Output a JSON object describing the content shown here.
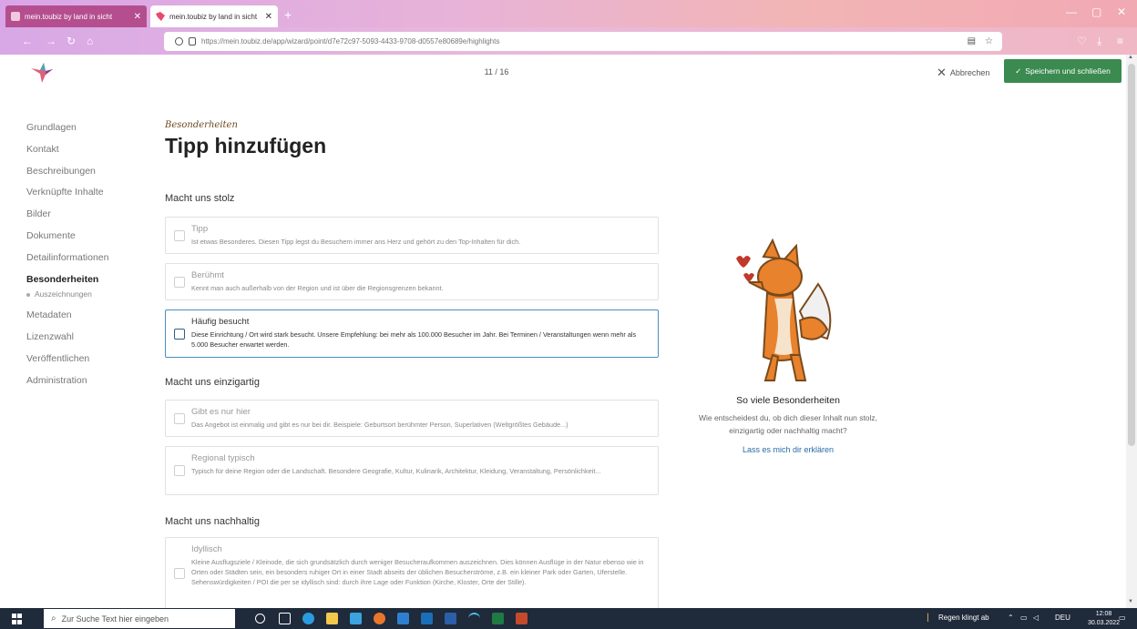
{
  "browser": {
    "tabs": [
      {
        "label": "mein.toubiz by land in sicht",
        "active": false
      },
      {
        "label": "mein.toubiz by land in sicht",
        "active": true
      }
    ],
    "new_tab": "+",
    "url": "https://mein.toubiz.de/app/wizard/point/d7e72c97-5093-4433-9708-d0557e80689e/highlights"
  },
  "header": {
    "step": "11 / 16",
    "cancel_label": "Abbrechen",
    "save_label": "Speichern und schließen"
  },
  "sidebar": {
    "items": [
      {
        "label": "Grundlagen"
      },
      {
        "label": "Kontakt"
      },
      {
        "label": "Beschreibungen"
      },
      {
        "label": "Verknüpfte Inhalte"
      },
      {
        "label": "Bilder"
      },
      {
        "label": "Dokumente"
      },
      {
        "label": "Detailinformationen"
      },
      {
        "label": "Besonderheiten",
        "active": true
      },
      {
        "label": "Metadaten"
      },
      {
        "label": "Lizenzwahl"
      },
      {
        "label": "Veröffentlichen"
      },
      {
        "label": "Administration"
      }
    ],
    "subitem": "Auszeichnungen"
  },
  "main": {
    "kicker": "Besonderheiten",
    "title": "Tipp hinzufügen",
    "sections": [
      {
        "title": "Macht uns stolz",
        "options": [
          {
            "title": "Tipp",
            "desc": "Ist etwas Besonderes. Diesen Tipp legst du Besuchern immer ans Herz und gehört zu den Top-Inhalten für dich."
          },
          {
            "title": "Berühmt",
            "desc": "Kennt man auch außerhalb von der Region und ist über die Regionsgrenzen bekannt."
          },
          {
            "title": "Häufig besucht",
            "desc": "Diese Einrichtung / Ort wird stark besucht. Unsere Empfehlung: bei mehr als 100.000 Besucher im Jahr. Bei Terminen / Veranstaltungen wenn mehr als 5.000 Besucher erwartet werden."
          }
        ]
      },
      {
        "title": "Macht uns einzigartig",
        "options": [
          {
            "title": "Gibt es nur hier",
            "desc": "Das Angebot ist einmalig und gibt es nur bei dir. Beispiele: Geburtsort berühmter Person, Superlativen (Weltgrößtes Gebäude...)"
          },
          {
            "title": "Regional typisch",
            "desc": "Typisch für deine Region oder die Landschaft. Besondere Geografie, Kultur, Kulinarik, Architektur, Kleidung, Veranstaltung, Persönlichkeit..."
          }
        ]
      },
      {
        "title": "Macht uns nachhaltig",
        "options": [
          {
            "title": "Idyllisch",
            "desc": "Kleine Ausflugsziele / Kleinode, die sich grundsätzlich durch weniger Besucheraufkommen auszeichnen. Dies können Ausflüge in der Natur ebenso wie in Orten oder Städten sein, ein besonders ruhiger Ort in einer Stadt abseits der üblichen Besucherströme, z.B. ein kleiner Park oder Garten, Uferstelle. Sehenswürdigkeiten / POI die per se idyllisch sind: durch ihre Lage oder Funktion (Kirche, Kloster, Orte der Stille)."
          }
        ]
      }
    ]
  },
  "info": {
    "title": "So viele Besonderheiten",
    "text": "Wie entscheidest du, ob dich dieser Inhalt nun stolz, einzigartig oder nachhaltig macht?",
    "link": "Lass es mich dir erklären"
  },
  "taskbar": {
    "search_placeholder": "Zur Suche Text hier eingeben",
    "weather": "Regen klingt ab",
    "lang": "DEU",
    "time": "12:08",
    "date": "30.03.2022"
  },
  "colors": {
    "accent_green": "#3b8a4f",
    "link_blue": "#2a6ca6",
    "focus_border": "#4a8fbf",
    "kicker_brown": "#6d4a1e"
  }
}
